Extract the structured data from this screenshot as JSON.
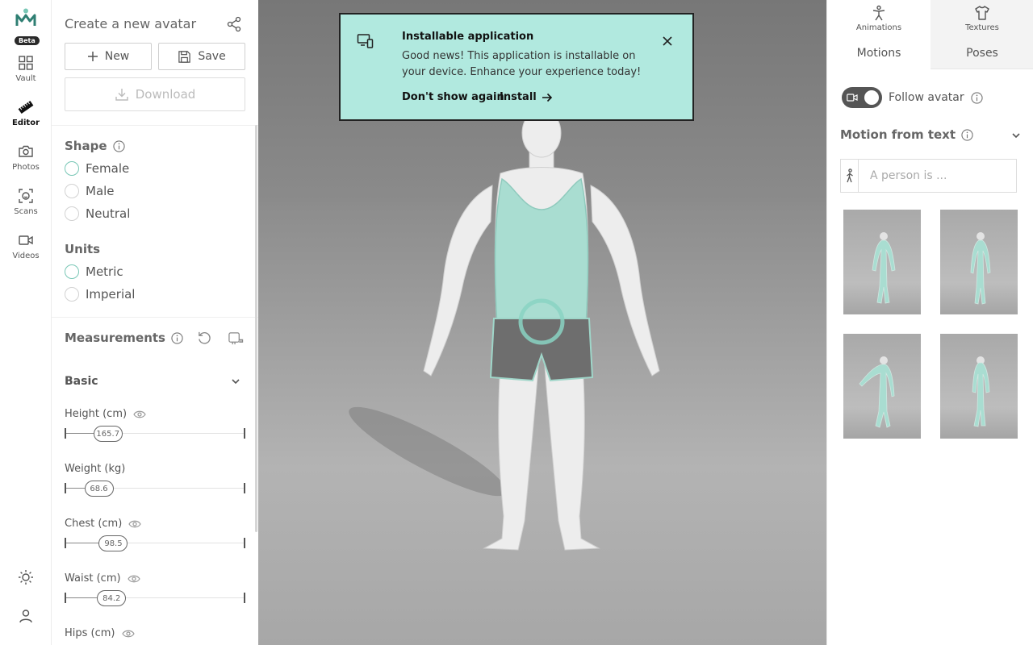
{
  "nav": {
    "beta": "Beta",
    "items": [
      {
        "label": "Vault",
        "icon": "grid-icon"
      },
      {
        "label": "Editor",
        "icon": "ruler-icon",
        "active": true
      },
      {
        "label": "Photos",
        "icon": "camera-icon"
      },
      {
        "label": "Scans",
        "icon": "face-scan-icon"
      },
      {
        "label": "Videos",
        "icon": "video-icon"
      }
    ]
  },
  "panel": {
    "title": "Create a new avatar",
    "new_label": "New",
    "save_label": "Save",
    "download_label": "Download",
    "shape": {
      "title": "Shape",
      "options": [
        "Female",
        "Male",
        "Neutral"
      ],
      "selected": "Female"
    },
    "units": {
      "title": "Units",
      "options": [
        "Metric",
        "Imperial"
      ],
      "selected": "Metric"
    },
    "measurements": {
      "title": "Measurements",
      "section": "Basic",
      "items": [
        {
          "label": "Height (cm)",
          "value": "165.7",
          "fraction": 0.24,
          "eye": true
        },
        {
          "label": "Weight (kg)",
          "value": "68.6",
          "fraction": 0.19,
          "eye": false
        },
        {
          "label": "Chest (cm)",
          "value": "98.5",
          "fraction": 0.27,
          "eye": true
        },
        {
          "label": "Waist (cm)",
          "value": "84.2",
          "fraction": 0.26,
          "eye": true
        },
        {
          "label": "Hips (cm)",
          "value": "",
          "fraction": 0.25,
          "eye": true
        }
      ]
    }
  },
  "toast": {
    "title": "Installable application",
    "body": "Good news! This application is installable on your device. Enhance your experience today!",
    "dont_show": "Don't show again",
    "install": "Install"
  },
  "right": {
    "tab_animations": "Animations",
    "tab_textures": "Textures",
    "sub_motions": "Motions",
    "sub_poses": "Poses",
    "follow_avatar": "Follow avatar",
    "motion_from_text": "Motion from text",
    "prompt_placeholder": "A person is ..."
  },
  "colors": {
    "accent": "#b1e9df",
    "radio_selected": "#79c7b6",
    "avatar_skin": "#ededed",
    "tank_top": "#a9ddd1",
    "shorts": "#6e6e6e"
  }
}
